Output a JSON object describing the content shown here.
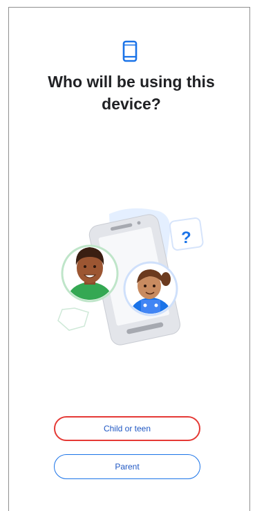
{
  "screen": {
    "title": "Who will be using this device?",
    "icon": "smartphone-icon"
  },
  "illustration": {
    "question_mark": "?"
  },
  "options": [
    {
      "label": "Child or teen",
      "selected": true
    },
    {
      "label": "Parent",
      "selected": false
    }
  ],
  "colors": {
    "accent": "#1a73e8",
    "selected_border": "#e53935"
  }
}
